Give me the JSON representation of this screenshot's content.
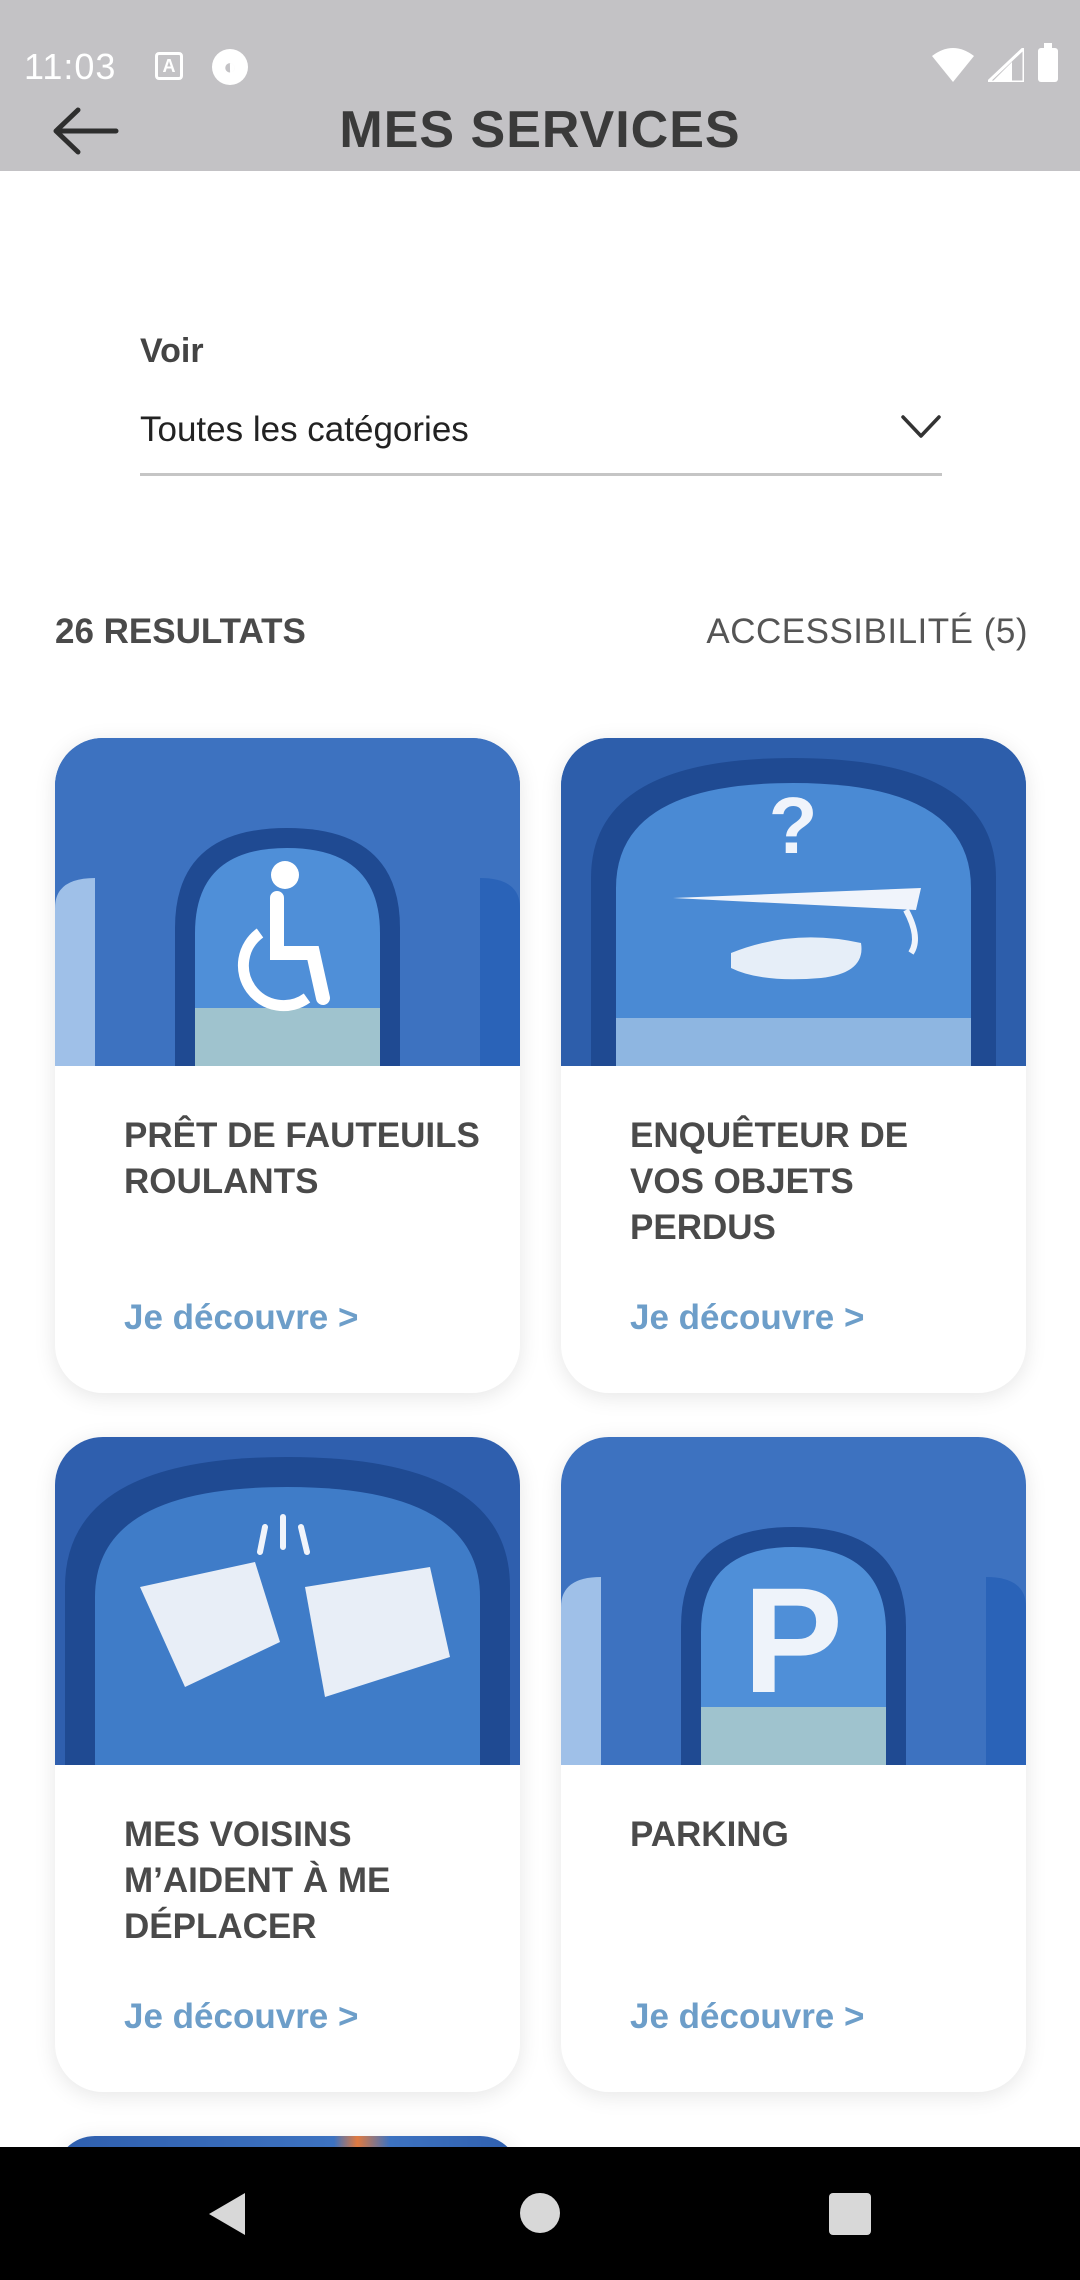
{
  "status_bar": {
    "time": "11:03",
    "icon_a": "A"
  },
  "app_bar": {
    "title": "MES SERVICES"
  },
  "filter": {
    "label": "Voir",
    "value": "Toutes les catégories"
  },
  "results": {
    "count": "26 RESULTATS",
    "active_filter": "ACCESSIBILITÉ (5)"
  },
  "cards": [
    {
      "title": "PRÊT DE FAUTEUILS ROULANTS",
      "link": "Je découvre >",
      "icon": "wheelchair-icon"
    },
    {
      "title": "ENQUÊTEUR DE VOS OBJETS PERDUS",
      "link": "Je découvre >",
      "icon": "lost-objects-icon"
    },
    {
      "title": "MES VOISINS M’AIDENT À ME DÉPLACER",
      "link": "Je découvre >",
      "icon": "handshake-icon"
    },
    {
      "title": "PARKING",
      "link": "Je découvre >",
      "icon": "parking-icon"
    }
  ],
  "colors": {
    "topbar": "#c3c2c5",
    "sky": "#3f78c4",
    "link": "#6d9ec9"
  }
}
